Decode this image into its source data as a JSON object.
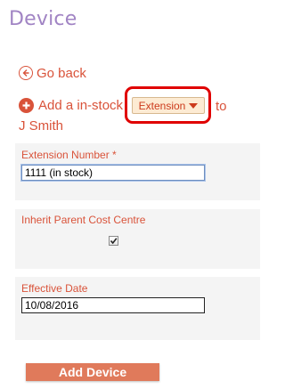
{
  "page": {
    "title": "Device"
  },
  "nav": {
    "go_back": "Go back"
  },
  "add_row": {
    "prefix": "Add a in-stock",
    "selected_type": "Extension",
    "to": "to",
    "user_name": "J Smith"
  },
  "extension_field": {
    "label": "Extension Number *",
    "value": "1111 (in stock)"
  },
  "inherit_field": {
    "label": "Inherit Parent Cost Centre",
    "checked": true
  },
  "date_field": {
    "label": "Effective Date",
    "value": "10/08/2016"
  },
  "actions": {
    "add_device": "Add Device"
  },
  "colors": {
    "accent": "#d9533a",
    "title": "#a184c4",
    "button": "#e07a5b",
    "highlight": "#e00000"
  }
}
